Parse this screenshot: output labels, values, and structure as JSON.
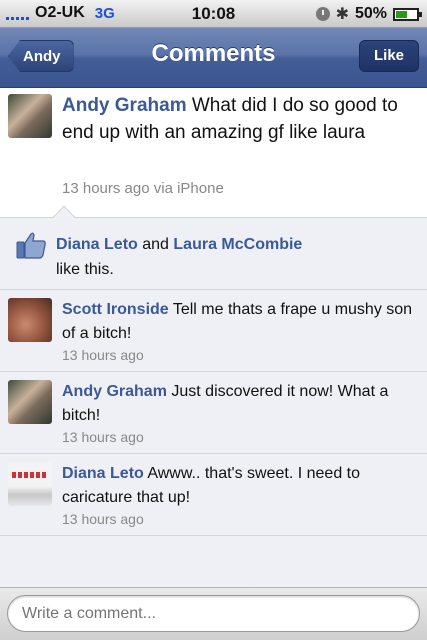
{
  "status_bar": {
    "carrier": "O2-UK",
    "network": "3G",
    "time": "10:08",
    "battery": "50%",
    "battery_level": 0.5,
    "icons": [
      "signal-icon",
      "lock-rotation-icon",
      "bluetooth-icon",
      "battery-icon"
    ]
  },
  "navbar": {
    "back_label": "Andy",
    "title": "Comments",
    "like_label": "Like"
  },
  "post": {
    "author": "Andy Graham",
    "message": "What did I do so good to end up with an amazing gf like laura",
    "meta": "13 hours ago via iPhone"
  },
  "likes": {
    "user1": "Diana Leto",
    "conjunction": "and",
    "user2": "Laura McCombie",
    "suffix": "like this.",
    "icon": "thumbs-up-icon"
  },
  "comments": [
    {
      "author": "Scott Ironside",
      "message": "Tell me thats a frape u mushy son of a bitch!",
      "meta": "13 hours ago"
    },
    {
      "author": "Andy Graham",
      "message": "Just discovered it now! What a bitch!",
      "meta": "13 hours ago"
    },
    {
      "author": "Diana Leto",
      "message": "Awww.. that's sweet. I need to caricature that up!",
      "meta": "13 hours ago"
    }
  ],
  "composer": {
    "placeholder": "Write a comment..."
  },
  "colors": {
    "navbar": "#3b5590",
    "name_link": "#3b5998",
    "background": "#eef0f5"
  }
}
